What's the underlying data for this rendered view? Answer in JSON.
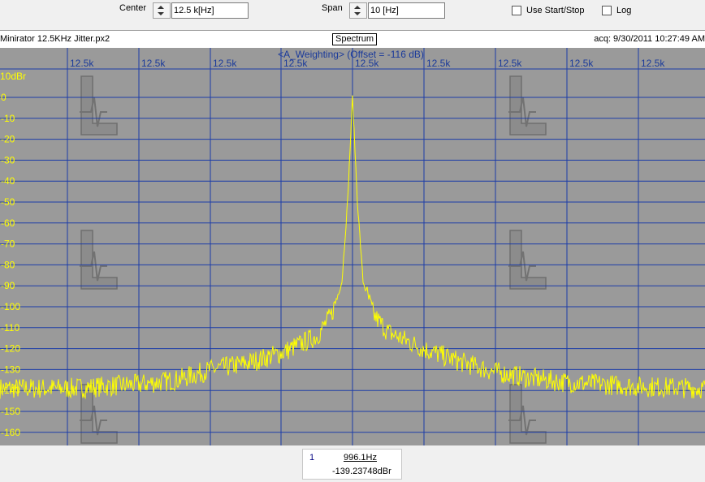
{
  "toolbar": {
    "center_label": "Center",
    "center_value": "12.5 k[Hz]",
    "span_label": "Span",
    "span_value": "10 [Hz]",
    "start_stop_label": "Use Start/Stop",
    "log_label": "Log"
  },
  "infobar": {
    "filename": "Minirator 12.5KHz Jitter.px2",
    "mode": "Spectrum",
    "acq": "acq: 9/30/2011 10:27:49 AM"
  },
  "readout": {
    "index": "1",
    "frequency": "996.1Hz",
    "value": "-139.23748dBr"
  },
  "colors": {
    "plot_bg": "#9a9a9a",
    "grid": "#1c3ca8",
    "trace": "#ffff00",
    "y_labels": "#ffff00",
    "x_labels": "#1a3a9a"
  },
  "chart_data": {
    "type": "line",
    "title": "<A_Weighting> (Offset = -116 dB)",
    "ylabel": "10dBr",
    "x_tick_labels": [
      "12.5k",
      "12.5k",
      "12.5k",
      "12.5k",
      "12.5k",
      "12.5k",
      "12.5k",
      "12.5k",
      "12.5k"
    ],
    "y_tick_labels": [
      "0",
      "-10",
      "-20",
      "-30",
      "-40",
      "-50",
      "-60",
      "-70",
      "-80",
      "-90",
      "-100",
      "-110",
      "-120",
      "-130",
      "-140",
      "-150",
      "-160"
    ],
    "xlim": [
      12495,
      12505
    ],
    "ylim": [
      -165,
      5
    ],
    "grid": true,
    "series": [
      {
        "x": [
          12495,
          12496,
          12497,
          12497.5,
          12498,
          12498.5,
          12499,
          12499.5,
          12499.7,
          12499.85,
          12499.93,
          12500,
          12500.07,
          12500.15,
          12500.3,
          12500.5,
          12501,
          12501.5,
          12502,
          12502.5,
          12503,
          12504,
          12505
        ],
        "y": [
          -139,
          -139,
          -137,
          -135,
          -130,
          -127,
          -122,
          -114,
          -104,
          -88,
          -50,
          0,
          -50,
          -88,
          -104,
          -112,
          -120,
          -126,
          -131,
          -134,
          -136,
          -138,
          -139
        ]
      }
    ]
  }
}
